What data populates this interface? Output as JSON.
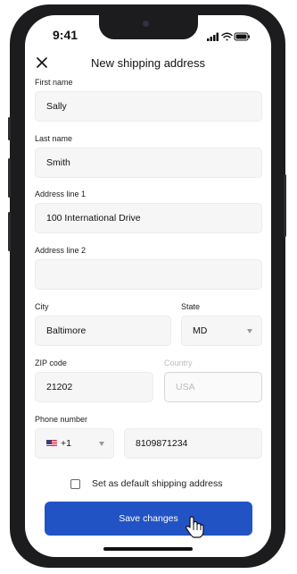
{
  "status_bar": {
    "time": "9:41"
  },
  "header": {
    "title": "New shipping address",
    "close_icon": "close-icon"
  },
  "form": {
    "first_name": {
      "label": "First name",
      "value": "Sally"
    },
    "last_name": {
      "label": "Last name",
      "value": "Smith"
    },
    "address_line_1": {
      "label": "Address line 1",
      "value": "100 International Drive"
    },
    "address_line_2": {
      "label": "Address line 2",
      "value": ""
    },
    "city": {
      "label": "City",
      "value": "Baltimore"
    },
    "state": {
      "label": "State",
      "value": "MD"
    },
    "zip": {
      "label": "ZIP code",
      "value": "21202"
    },
    "country": {
      "label": "Country",
      "value": "USA",
      "disabled": true
    },
    "phone": {
      "label": "Phone number",
      "country_code": "+1",
      "value": "8109871234",
      "flag_icon": "us-flag-icon"
    },
    "default_checkbox": {
      "label": "Set as default shipping address",
      "checked": false
    }
  },
  "actions": {
    "save_label": "Save changes",
    "save_color": "#2253c4"
  }
}
